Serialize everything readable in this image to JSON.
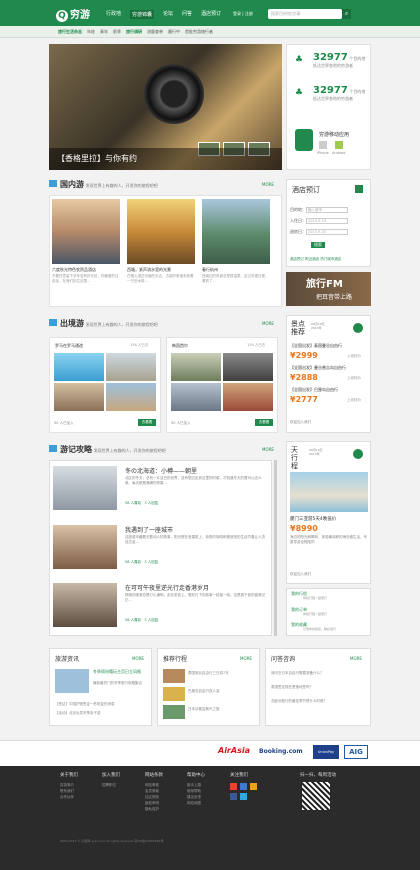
{
  "header": {
    "logo": "穷游",
    "nav": [
      "行政地",
      "穷游锦囊",
      "论坛",
      "问答",
      "酒店预订"
    ],
    "login": "登录",
    "register": "注册",
    "search_placeholder": "搜索目的地/文章"
  },
  "subnav": [
    "旅行生活杂志",
    "年轮",
    "青年",
    "前季",
    "旅行调研",
    "流量查单",
    "最行中",
    "首批穷游旅行者"
  ],
  "hero": {
    "caption": "【香格里拉】与你有约"
  },
  "stats": [
    {
      "num": "32977",
      "lbl": "个目的地",
      "sub": "抵达世界各地的穷游者"
    },
    {
      "num": "32977",
      "lbl": "个目的地",
      "sub": "抵达世界各地的穷游者"
    }
  ],
  "app": {
    "title": "穷游移动应用",
    "iphone": "iPhone",
    "android": "Android"
  },
  "domestic": {
    "title": "国内游",
    "sub": "发现世界上有趣的人，开发你的旅程吧吧",
    "more": "MORE",
    "items": [
      {
        "title": "六度秋光特色农贸品酒店",
        "desc": "不要任意留下多年没有好去处，你最爱的往前走，在我们的生活里…"
      },
      {
        "title": "西塘，紧声流水里的光景",
        "desc": "在烟火漫过河面的天边，古镇的角落安放着一只旧木椅…"
      },
      {
        "title": "春行杭州",
        "desc": "西湖边的风景总是很温柔，走过苏堤白堤，看到了…"
      }
    ]
  },
  "hotel": {
    "title": "酒店预订",
    "dest_label": "目的地：",
    "dest": "输入城市",
    "in_label": "入住日：",
    "in": "2013-9-19",
    "out_label": "退房日：",
    "out": "2013-9-20",
    "btn": "搜索",
    "links": "酒店预订  附近酒店  热门城市酒店"
  },
  "fm": {
    "title": "旅行FM",
    "sub": "把耳音带上路"
  },
  "outbound": {
    "title": "出境游",
    "sub": "发现世界上有趣的人，开发你的旅程吧吧",
    "more": "MORE",
    "a": "罗马在罗马通途",
    "a_count": "156 人已去",
    "b": "韩国首尔",
    "b_count": "156 人已去",
    "a_btn": "去看看",
    "b_btn": "去看看",
    "a_foot": "50 人已加入",
    "b_foot": "50 人已加入"
  },
  "deals": {
    "title": "景点推荐",
    "date": "09月19日 2013年",
    "items": [
      {
        "name": "【全国出发】泰国曼谷自由行",
        "price": "¥2999",
        "tag": "上线特价"
      },
      {
        "name": "【全国出发】曼谷普吉岛自由行",
        "price": "¥2888",
        "tag": "上线特价"
      },
      {
        "name": "【全国出发】巴厘岛自由行",
        "price": "¥2777",
        "tag": "上线特价"
      }
    ],
    "foot": "欢迎加入我们"
  },
  "guides": {
    "title": "游记攻略",
    "sub": "发现世界上有趣的人，开发你的旅程吧吧",
    "more": "MORE",
    "items": [
      {
        "title": "冬の北海道：小樽——朝里",
        "desc": "北区的冬天，总有一片洁白的世界，没有想过走到这里的时候，才知道冬天的雪可以这么美，每天都是满满的惊喜…",
        "meta": "58 人喜欢 · 3 人回复"
      },
      {
        "title": "我遇到了一座城市",
        "desc": "这座城市藏着无数动人的故事，阳光照在老建筑上，街角的咖啡和慢悠悠的生活节奏让人流连忘返…",
        "meta": "58 人喜欢 · 3 人回复"
      },
      {
        "title": "在可可午夜里逆光行走香港岁月",
        "desc": "夜晚的维港总是灯火通明，走在老街上，霓虹灯下的故事一段接一段，这是属于我的香港记忆…",
        "meta": "58 人喜欢 · 3 人回复"
      }
    ]
  },
  "tianxing": {
    "title": "天行程",
    "date": "09月19日 2013年",
    "name": "厦门三亚游5天4晚低价",
    "price": "¥8990",
    "desc": "海边的阳光和椰林，体验最纯粹的海岛慢生活，专属导游全程陪同",
    "foot": "欢迎加入我们"
  },
  "trips": [
    {
      "t": "我的行程",
      "d": "你和行程一起旅行"
    },
    {
      "t": "我的订单",
      "d": "你和行程一起旅行"
    },
    {
      "t": "我的收藏",
      "d": "记录你的旅途，精彩旅行"
    }
  ],
  "news": {
    "title": "旅游资讯",
    "more": "MORE",
    "head": "冬季缤纷嘻玩主页日立风格",
    "sub": "最新最热门的冬季旅行攻略集合",
    "items": [
      "【签证】中国护照签证一秒批复的消息",
      "【活动】北京出发冬季亲子游"
    ]
  },
  "plan": {
    "title": "推荐行程",
    "more": "MORE",
    "items": [
      "泰国曼谷自由行三日游7天",
      "巴厘岛自由行双人游",
      "日本京都赏枫叶之旅"
    ]
  },
  "qa": {
    "title": "问答咨询",
    "more": "MORE",
    "items": [
      "请问去日本自由行需要准备什么？",
      "泰国签证现在是落地签吗？",
      "去欧洲旅行的最佳季节是什么时候？"
    ]
  },
  "partners": [
    "AirAsia",
    "Booking.com",
    "UnionPay",
    "AIG"
  ],
  "footer": {
    "cols": [
      {
        "h": "关于我们",
        "l": [
          "穷游简介",
          "联系我们",
          "合作伙伴"
        ]
      },
      {
        "h": "加入我们",
        "l": [
          "招聘职位"
        ]
      },
      {
        "h": "网站条款",
        "l": [
          "网站条款",
          "会员条款",
          "社区规则",
          "版权声明",
          "隐私保护"
        ]
      },
      {
        "h": "帮助中心",
        "l": [
          "新手上路",
          "使用帮助",
          "建议反馈",
          "网站地图"
        ]
      },
      {
        "h": "关注我们",
        "l": []
      }
    ],
    "qr": "扫一扫，每周活动",
    "copy": "2004-2013 © 穷游网 qyer.com All rights reserved  京ICP备12003524号"
  }
}
